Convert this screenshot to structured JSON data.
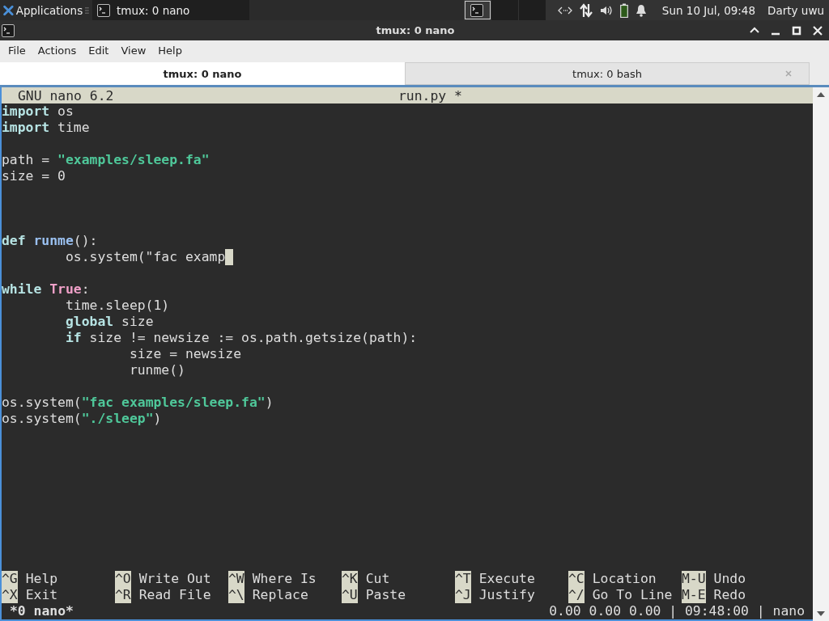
{
  "taskbar": {
    "apps_label": "Applications",
    "windows": [
      {
        "title": "tmux: 0 nano",
        "selected": false
      }
    ],
    "workspaces": [
      {
        "selected": true
      },
      {
        "selected": false
      },
      {
        "selected": false
      }
    ],
    "clock": "Sun 10 Jul, 09:48",
    "user": "Darty uwu"
  },
  "window": {
    "title": "tmux: 0 nano"
  },
  "menu": [
    "File",
    "Actions",
    "Edit",
    "View",
    "Help"
  ],
  "tabs": [
    {
      "label": "tmux: 0 nano",
      "selected": true
    },
    {
      "label": "tmux: 0 bash",
      "selected": false
    }
  ],
  "nano": {
    "version": "GNU nano 6.2",
    "filename": "run.py *",
    "lines": [
      {
        "kind": "code",
        "segments": [
          {
            "text": "import",
            "kind": "keyword"
          },
          {
            "text": " os",
            "kind": "plain"
          }
        ]
      },
      {
        "kind": "code",
        "segments": [
          {
            "text": "import",
            "kind": "keyword"
          },
          {
            "text": " time",
            "kind": "plain"
          }
        ]
      },
      {
        "kind": "blank"
      },
      {
        "kind": "code",
        "segments": [
          {
            "text": "path = ",
            "kind": "plain"
          },
          {
            "text": "\"examples/sleep.fa\"",
            "kind": "string"
          }
        ]
      },
      {
        "kind": "code",
        "segments": [
          {
            "text": "size = 0",
            "kind": "plain"
          }
        ]
      },
      {
        "kind": "blank"
      },
      {
        "kind": "blank"
      },
      {
        "kind": "blank"
      },
      {
        "kind": "code",
        "segments": [
          {
            "text": "def",
            "kind": "keyword"
          },
          {
            "text": " runme",
            "kind": "function"
          },
          {
            "text": "():",
            "kind": "plain"
          }
        ]
      },
      {
        "kind": "code",
        "cursor": true,
        "segments": [
          {
            "text": "        os.system(\"fac examp",
            "kind": "plain"
          }
        ]
      },
      {
        "kind": "blank"
      },
      {
        "kind": "code",
        "segments": [
          {
            "text": "while",
            "kind": "keyword"
          },
          {
            "text": " True",
            "kind": "constant"
          },
          {
            "text": ":",
            "kind": "plain"
          }
        ]
      },
      {
        "kind": "code",
        "segments": [
          {
            "text": "        time.sleep(1)",
            "kind": "plain"
          }
        ]
      },
      {
        "kind": "code",
        "segments": [
          {
            "text": "        global",
            "kind": "keyword"
          },
          {
            "text": " size",
            "kind": "plain"
          }
        ]
      },
      {
        "kind": "code",
        "segments": [
          {
            "text": "        if",
            "kind": "keyword"
          },
          {
            "text": " size != newsize := os.path.getsize(path):",
            "kind": "plain"
          }
        ]
      },
      {
        "kind": "code",
        "segments": [
          {
            "text": "                size = newsize",
            "kind": "plain"
          }
        ]
      },
      {
        "kind": "code",
        "segments": [
          {
            "text": "                runme()",
            "kind": "plain"
          }
        ]
      },
      {
        "kind": "blank"
      },
      {
        "kind": "code",
        "segments": [
          {
            "text": "os.system(",
            "kind": "plain"
          },
          {
            "text": "\"fac examples/sleep.fa\"",
            "kind": "string"
          },
          {
            "text": ")",
            "kind": "plain"
          }
        ]
      },
      {
        "kind": "code",
        "segments": [
          {
            "text": "os.system(",
            "kind": "plain"
          },
          {
            "text": "\"./sleep\"",
            "kind": "string"
          },
          {
            "text": ")",
            "kind": "plain"
          }
        ]
      }
    ],
    "shortcuts": [
      [
        {
          "key": "^G",
          "label": "Help"
        },
        {
          "key": "^O",
          "label": "Write Out"
        },
        {
          "key": "^W",
          "label": "Where Is"
        },
        {
          "key": "^K",
          "label": "Cut"
        },
        {
          "key": "^T",
          "label": "Execute"
        },
        {
          "key": "^C",
          "label": "Location"
        },
        {
          "key": "M-U",
          "label": "Undo"
        }
      ],
      [
        {
          "key": "^X",
          "label": "Exit"
        },
        {
          "key": "^R",
          "label": "Read File"
        },
        {
          "key": "^\\",
          "label": "Replace"
        },
        {
          "key": "^U",
          "label": "Paste"
        },
        {
          "key": "^J",
          "label": "Justify"
        },
        {
          "key": "^/",
          "label": "Go To Line"
        },
        {
          "key": "M-E",
          "label": "Redo"
        }
      ]
    ]
  },
  "tmux_status": {
    "window": "*0 nano*",
    "right": "0.00 0.00 0.00 | 09:48:00 | nano"
  }
}
